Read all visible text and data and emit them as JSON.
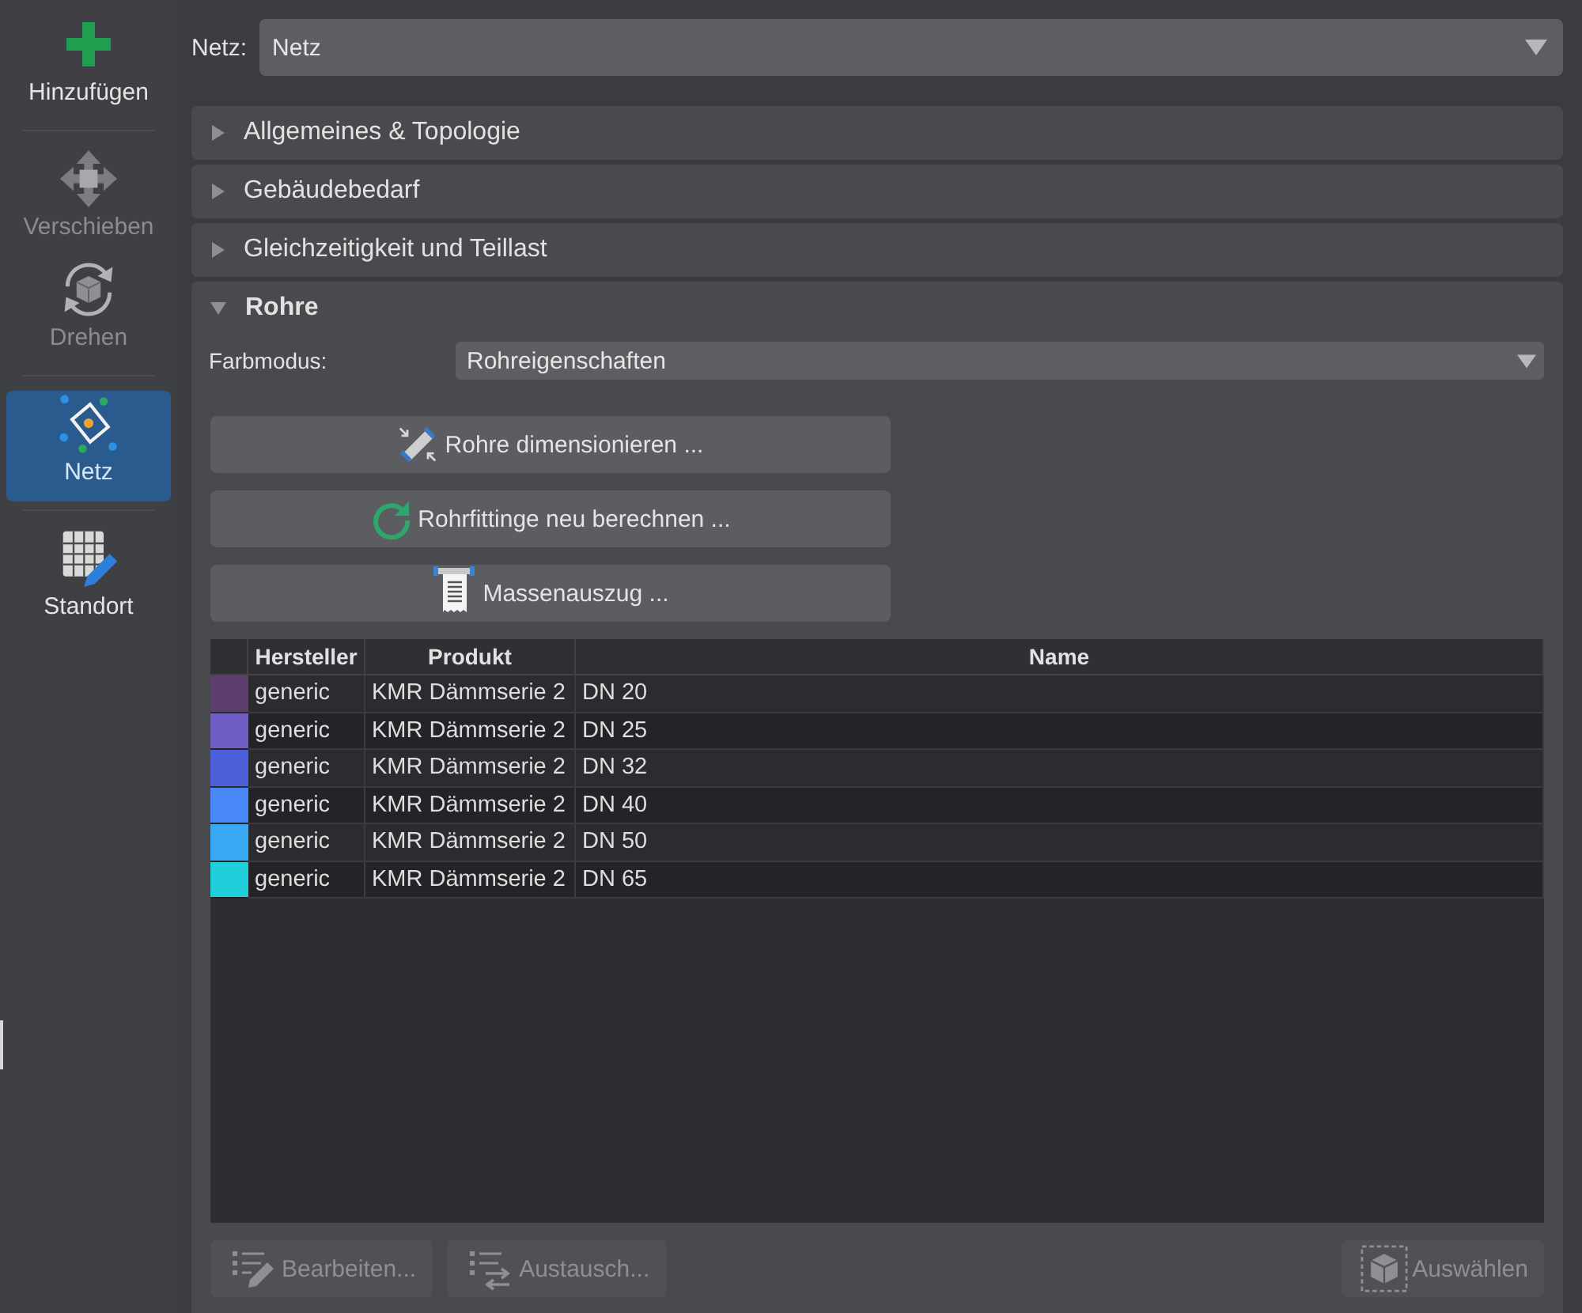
{
  "sidebar": {
    "groups": [
      {
        "items": [
          {
            "kind": "add",
            "label": "Hinzufügen",
            "disabled": false,
            "selected": false
          }
        ]
      },
      {
        "items": [
          {
            "kind": "move",
            "label": "Verschieben",
            "disabled": true,
            "selected": false
          },
          {
            "kind": "rotate",
            "label": "Drehen",
            "disabled": true,
            "selected": false
          }
        ]
      },
      {
        "items": [
          {
            "kind": "network",
            "label": "Netz",
            "disabled": false,
            "selected": true
          }
        ]
      },
      {
        "items": [
          {
            "kind": "site",
            "label": "Standort",
            "disabled": false,
            "selected": false
          }
        ]
      }
    ]
  },
  "network_selector": {
    "label": "Netz:",
    "value": "Netz"
  },
  "sections": [
    {
      "title": "Allgemeines & Topologie",
      "expanded": false
    },
    {
      "title": "Gebäudebedarf",
      "expanded": false
    },
    {
      "title": "Gleichzeitigkeit und Teillast",
      "expanded": false
    },
    {
      "title": "Rohre",
      "expanded": true,
      "color_mode": {
        "label": "Farbmodus:",
        "value": "Rohreigenschaften"
      },
      "actions": [
        {
          "kind": "dimension",
          "label": "Rohre dimensionieren ..."
        },
        {
          "kind": "recalculate",
          "label": "Rohrfittinge neu berechnen ..."
        },
        {
          "kind": "bill",
          "label": "Massenauszug ..."
        }
      ],
      "table": {
        "columns": [
          "Hersteller",
          "Produkt",
          "Name"
        ],
        "rows": [
          {
            "color": "#5c3f6c",
            "cells": [
              "generic",
              "KMR Dämmserie 2",
              "DN 20"
            ]
          },
          {
            "color": "#6f5fc5",
            "cells": [
              "generic",
              "KMR Dämmserie 2",
              "DN 25"
            ]
          },
          {
            "color": "#4a5fd8",
            "cells": [
              "generic",
              "KMR Dämmserie 2",
              "DN 32"
            ]
          },
          {
            "color": "#4a88f7",
            "cells": [
              "generic",
              "KMR Dämmserie 2",
              "DN 40"
            ]
          },
          {
            "color": "#39a9f6",
            "cells": [
              "generic",
              "KMR Dämmserie 2",
              "DN 50"
            ]
          },
          {
            "color": "#20cfd9",
            "cells": [
              "generic",
              "KMR Dämmserie 2",
              "DN 65"
            ]
          }
        ]
      },
      "footer": {
        "left": [
          {
            "kind": "edit",
            "label": "Bearbeiten...",
            "disabled": true
          },
          {
            "kind": "replace",
            "label": "Austausch...",
            "disabled": true
          }
        ],
        "right": [
          {
            "kind": "select",
            "label": "Auswählen",
            "disabled": true
          }
        ]
      }
    }
  ]
}
